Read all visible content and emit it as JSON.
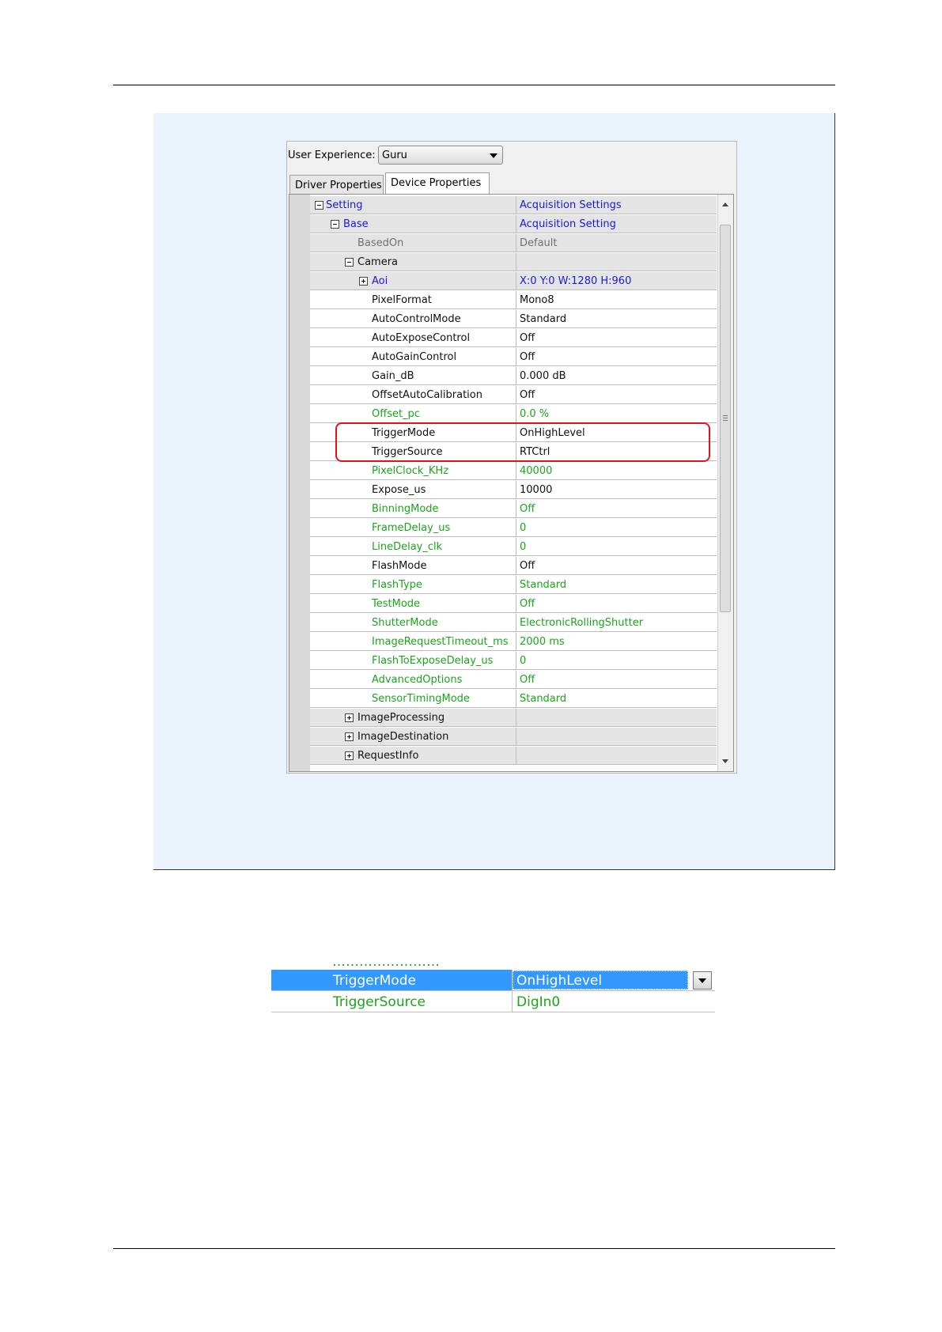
{
  "dialog": {
    "user_experience_label": "User Experience:",
    "user_experience_value": "Guru",
    "tabs": [
      "Driver Properties",
      "Device Properties"
    ]
  },
  "grid_rows": [
    {
      "name": "Setting",
      "value": "Acquisition Settings",
      "indent": 0,
      "toggle": "minus",
      "color": "blue",
      "shade": "grey"
    },
    {
      "name": "Base",
      "value": "Acquisition Setting",
      "indent": 1,
      "toggle": "minus",
      "color": "blue",
      "shade": "grey"
    },
    {
      "name": "BasedOn",
      "value": "Default",
      "indent": 2,
      "toggle": "",
      "color": "grey",
      "shade": "grey"
    },
    {
      "name": "Camera",
      "value": "",
      "indent": 2,
      "toggle": "minus",
      "color": "black",
      "shade": "grey"
    },
    {
      "name": "Aoi",
      "value": "X:0 Y:0 W:1280 H:960",
      "indent": 3,
      "toggle": "plus",
      "color": "blue",
      "shade": "grey"
    },
    {
      "name": "PixelFormat",
      "value": "Mono8",
      "indent": 3,
      "toggle": "",
      "color": "black",
      "shade": "white"
    },
    {
      "name": "AutoControlMode",
      "value": "Standard",
      "indent": 3,
      "toggle": "",
      "color": "black",
      "shade": "white"
    },
    {
      "name": "AutoExposeControl",
      "value": "Off",
      "indent": 3,
      "toggle": "",
      "color": "black",
      "shade": "white"
    },
    {
      "name": "AutoGainControl",
      "value": "Off",
      "indent": 3,
      "toggle": "",
      "color": "black",
      "shade": "white"
    },
    {
      "name": "Gain_dB",
      "value": "0.000 dB",
      "indent": 3,
      "toggle": "",
      "color": "black",
      "shade": "white"
    },
    {
      "name": "OffsetAutoCalibration",
      "value": "Off",
      "indent": 3,
      "toggle": "",
      "color": "black",
      "shade": "white"
    },
    {
      "name": "Offset_pc",
      "value": "0.0 %",
      "indent": 3,
      "toggle": "",
      "color": "green",
      "shade": "white"
    },
    {
      "name": "TriggerMode",
      "value": "OnHighLevel",
      "indent": 3,
      "toggle": "",
      "color": "black",
      "shade": "white"
    },
    {
      "name": "TriggerSource",
      "value": "RTCtrl",
      "indent": 3,
      "toggle": "",
      "color": "black",
      "shade": "white"
    },
    {
      "name": "PixelClock_KHz",
      "value": "40000",
      "indent": 3,
      "toggle": "",
      "color": "green",
      "shade": "white"
    },
    {
      "name": "Expose_us",
      "value": "10000",
      "indent": 3,
      "toggle": "",
      "color": "black",
      "shade": "white"
    },
    {
      "name": "BinningMode",
      "value": "Off",
      "indent": 3,
      "toggle": "",
      "color": "green",
      "shade": "white"
    },
    {
      "name": "FrameDelay_us",
      "value": "0",
      "indent": 3,
      "toggle": "",
      "color": "green",
      "shade": "white"
    },
    {
      "name": "LineDelay_clk",
      "value": "0",
      "indent": 3,
      "toggle": "",
      "color": "green",
      "shade": "white"
    },
    {
      "name": "FlashMode",
      "value": "Off",
      "indent": 3,
      "toggle": "",
      "color": "black",
      "shade": "white"
    },
    {
      "name": "FlashType",
      "value": "Standard",
      "indent": 3,
      "toggle": "",
      "color": "green",
      "shade": "white"
    },
    {
      "name": "TestMode",
      "value": "Off",
      "indent": 3,
      "toggle": "",
      "color": "green",
      "shade": "white"
    },
    {
      "name": "ShutterMode",
      "value": "ElectronicRollingShutter",
      "indent": 3,
      "toggle": "",
      "color": "green",
      "shade": "white"
    },
    {
      "name": "ImageRequestTimeout_ms",
      "value": "2000 ms",
      "indent": 3,
      "toggle": "",
      "color": "green",
      "shade": "white"
    },
    {
      "name": "FlashToExposeDelay_us",
      "value": "0",
      "indent": 3,
      "toggle": "",
      "color": "green",
      "shade": "white"
    },
    {
      "name": "AdvancedOptions",
      "value": "Off",
      "indent": 3,
      "toggle": "",
      "color": "green",
      "shade": "white"
    },
    {
      "name": "SensorTimingMode",
      "value": "Standard",
      "indent": 3,
      "toggle": "",
      "color": "green",
      "shade": "white"
    },
    {
      "name": "ImageProcessing",
      "value": "",
      "indent": 2,
      "toggle": "plus",
      "color": "black",
      "shade": "grey"
    },
    {
      "name": "ImageDestination",
      "value": "",
      "indent": 2,
      "toggle": "plus",
      "color": "black",
      "shade": "grey"
    },
    {
      "name": "RequestInfo",
      "value": "",
      "indent": 2,
      "toggle": "plus",
      "color": "black",
      "shade": "grey"
    }
  ],
  "crop": {
    "rows": [
      {
        "name": "TriggerMode",
        "value": "OnHighLevel",
        "selected": true
      },
      {
        "name": "TriggerSource",
        "value": "DigIn0",
        "selected": false
      }
    ]
  },
  "colors": {
    "blue": "#1a1ad6",
    "green": "#1aa51a",
    "grey": "#707070",
    "black": "#111111",
    "selection": "#3399ff",
    "highlight": "#e0151a",
    "panel": "#eaf3fb"
  }
}
